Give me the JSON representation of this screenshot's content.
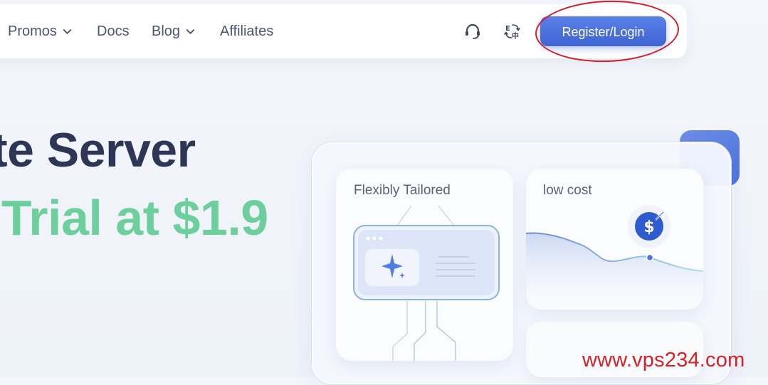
{
  "nav": {
    "items": [
      {
        "label": "Promos",
        "dropdown": true
      },
      {
        "label": "Docs",
        "dropdown": false
      },
      {
        "label": "Blog",
        "dropdown": true
      },
      {
        "label": "Affiliates",
        "dropdown": false
      }
    ],
    "support_icon": "headset-icon",
    "language_icon": "language-switch-icon",
    "register_label": "Register/Login"
  },
  "hero": {
    "line1": "te Server",
    "line2": "/ Trial at $1.9"
  },
  "cards": {
    "tailored_title": "Flexibly Tailored",
    "cost_title": "low cost"
  },
  "watermark": "www.vps234.com",
  "colors": {
    "primary": "#4a6fdc",
    "accent_green": "#6ccf9c",
    "heading": "#2d3654",
    "annotation_red": "#d21e2b"
  }
}
